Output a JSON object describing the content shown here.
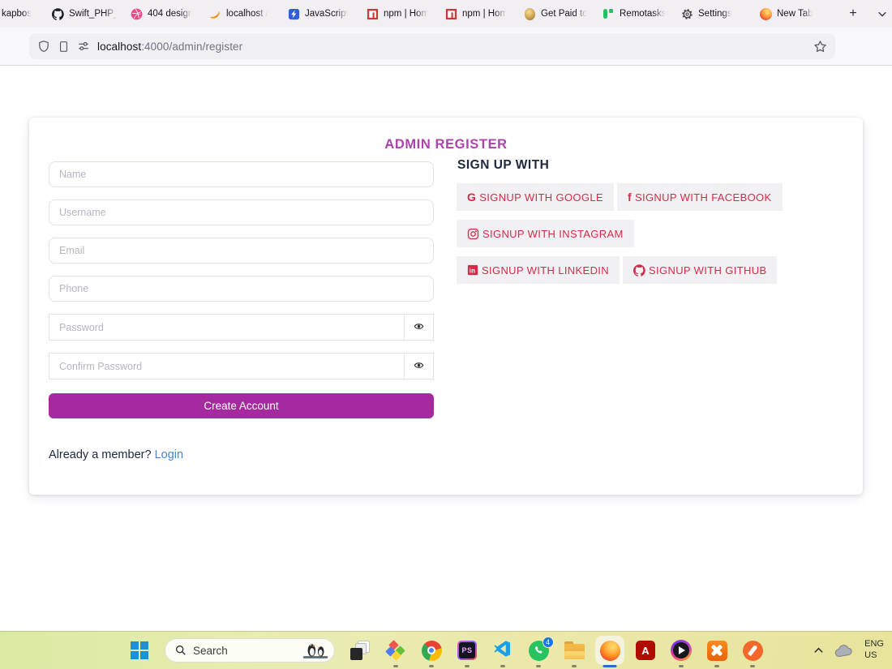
{
  "browser": {
    "tabs": [
      {
        "label": "kapbos",
        "icon": "none"
      },
      {
        "label": "Swift_PHP_",
        "icon": "github-icon"
      },
      {
        "label": "404 design",
        "icon": "dribbble-icon"
      },
      {
        "label": "localhost /",
        "icon": "phpmyadmin-icon"
      },
      {
        "label": "JavaScript",
        "icon": "javascript-icon"
      },
      {
        "label": "npm | Hom",
        "icon": "npm-icon"
      },
      {
        "label": "npm | Hom",
        "icon": "npm-icon"
      },
      {
        "label": "Get Paid to",
        "icon": "gold-ear-icon"
      },
      {
        "label": "Remotasks",
        "icon": "remotasks-icon"
      },
      {
        "label": "Settings",
        "icon": "gear-icon"
      },
      {
        "label": "New Tab",
        "icon": "firefox-icon"
      }
    ],
    "new_tab_label": "+",
    "url_host": "localhost",
    "url_rest": ":4000/admin/register"
  },
  "page": {
    "title": "ADMIN REGISTER",
    "form": {
      "name_placeholder": "Name",
      "username_placeholder": "Username",
      "email_placeholder": "Email",
      "phone_placeholder": "Phone",
      "password_placeholder": "Password",
      "confirm_placeholder": "Confirm Password",
      "submit_label": "Create Account",
      "footer_text": "Already a member? ",
      "footer_link_label": "Login"
    },
    "social": {
      "heading": "SIGN UP WITH",
      "buttons": [
        {
          "label": "SIGNUP WITH GOOGLE",
          "icon": "google-icon"
        },
        {
          "label": "SIGNUP WITH FACEBOOK",
          "icon": "facebook-icon"
        },
        {
          "label": "SIGNUP WITH INSTAGRAM",
          "icon": "instagram-icon"
        },
        {
          "label": "SIGNUP WITH LINKEDIN",
          "icon": "linkedin-icon"
        },
        {
          "label": "SIGNUP WITH GITHUB",
          "icon": "github-icon"
        }
      ]
    },
    "colors": {
      "accent_purple": "#a62a9f",
      "title_purple": "#ad44ad",
      "social_red": "#d52b4a",
      "link_blue": "#4a86c8"
    }
  },
  "taskbar": {
    "search_placeholder": "Search",
    "whatsapp_badge": "4",
    "language_line1": "ENG",
    "language_line2": "US"
  }
}
